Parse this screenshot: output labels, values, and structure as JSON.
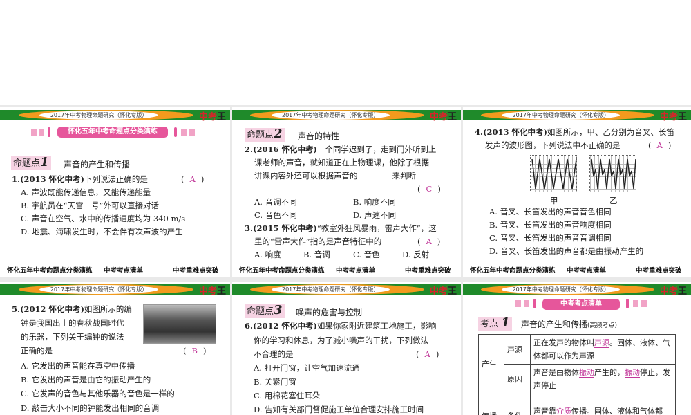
{
  "header_text": "2017年中考物理命题研究（怀化专版）",
  "logo": "中考王",
  "footer": {
    "a": "怀化五年中考命题点分类演练",
    "b": "中考考点清单",
    "c": "中考重难点突破"
  },
  "s1": {
    "banner": "怀化五年中考命题点分类演练",
    "tag": "命题点",
    "num": "1",
    "title": "声音的产生和传播",
    "q": "1.",
    "src": "(2013 怀化中考)",
    "stem": "下列说法正确的是",
    "answer": "A",
    "opts": [
      "A. 声波既能传递信息，又能传递能量",
      "B. 宇航员在“天宫一号”外可以直接对话",
      "C. 声音在空气、水中的传播速度均为 340 m/s",
      "D. 地震、海啸发生时，不会伴有次声波的产生"
    ]
  },
  "s2": {
    "tag": "命题点",
    "num": "2",
    "title": "声音的特性",
    "q2": {
      "num": "2.",
      "src": "(2016 怀化中考)",
      "l1": "一个同学迟到了，走到门外听到上",
      "l2": "课老师的声音，就知道正在上物理课，他除了根据",
      "l3a": "讲课内容外还可以根据声音的",
      "l3b": "来判断",
      "answer": "C",
      "opts": [
        "A. 音调不同",
        "B. 响度不同",
        "C. 音色不同",
        "D. 声速不同"
      ]
    },
    "q3": {
      "num": "3.",
      "src": "(2015 怀化中考)",
      "l1": "“教室外狂风暴雨，雷声大作”，这",
      "l2": "里的“雷声大作”指的是声音特征中的",
      "answer": "A",
      "opts": [
        "A. 响度",
        "B. 音调",
        "C. 音色",
        "D. 反射"
      ]
    }
  },
  "s3": {
    "num": "4.",
    "src": "(2013 怀化中考)",
    "l1": "如图所示，甲、乙分别为音叉、长笛",
    "l2": "发声的波形图，下列说法中不正确的是",
    "answer": "A",
    "fig1": "甲",
    "fig2": "乙",
    "opts": [
      "A. 音叉、长笛发出的声音音色相同",
      "B. 音叉、长笛发出的声音响度相同",
      "C. 音叉、长笛发出的声音音调相同",
      "D. 音叉、长笛发出的声音都是由振动产生的"
    ]
  },
  "s4": {
    "num": "5.",
    "src": "(2012 怀化中考)",
    "l1": "如图所示的编",
    "l2": "钟是我国出土的春秋战国时代",
    "l3": "的乐器，下列关于编钟的说法",
    "l4": "正确的是",
    "answer": "B",
    "opts": [
      "A. 它发出的声音能在真空中传播",
      "B. 它发出的声音是由它的振动产生的",
      "C. 它发声的音色与其他乐器的音色是一样的",
      "D. 敲击大小不同的钟能发出相同的音调"
    ]
  },
  "s5": {
    "tag": "命题点",
    "num": "3",
    "title": "噪声的危害与控制",
    "q": "6.",
    "src": "(2012 怀化中考)",
    "l1": "如果你家附近建筑工地施工，影响",
    "l2": "你的学习和休息，为了减小噪声的干扰，下列做法",
    "l3": "不合理的是",
    "answer": "A",
    "opts": [
      "A. 打开门窗，让空气加速流通",
      "B. 关紧门窗",
      "C. 用棉花塞住耳朵",
      "D. 告知有关部门督促施工单位合理安排施工时间"
    ]
  },
  "s6": {
    "banner": "中考考点清单",
    "tag": "考点",
    "num": "1",
    "title": "声音的产生和传播",
    "note": "(高频考点)",
    "t": {
      "r1": "产生",
      "r1a": "声源",
      "r1a_t1": "正在发声的物体叫",
      "r1a_h": "声源",
      "r1a_t2": "。固体、液体、气体都可以作为声源",
      "r1b": "原因",
      "r1b_t1": "声音是由物体",
      "r1b_h1": "振动",
      "r1b_t2": "产生的，",
      "r1b_h2": "振动",
      "r1b_t3": "停止，发声停止",
      "r2": "传播",
      "r2a": "条件",
      "r2a_t1": "声音靠",
      "r2a_h": "介质",
      "r2a_t2": "传播。固体、液体和气体都"
    }
  }
}
